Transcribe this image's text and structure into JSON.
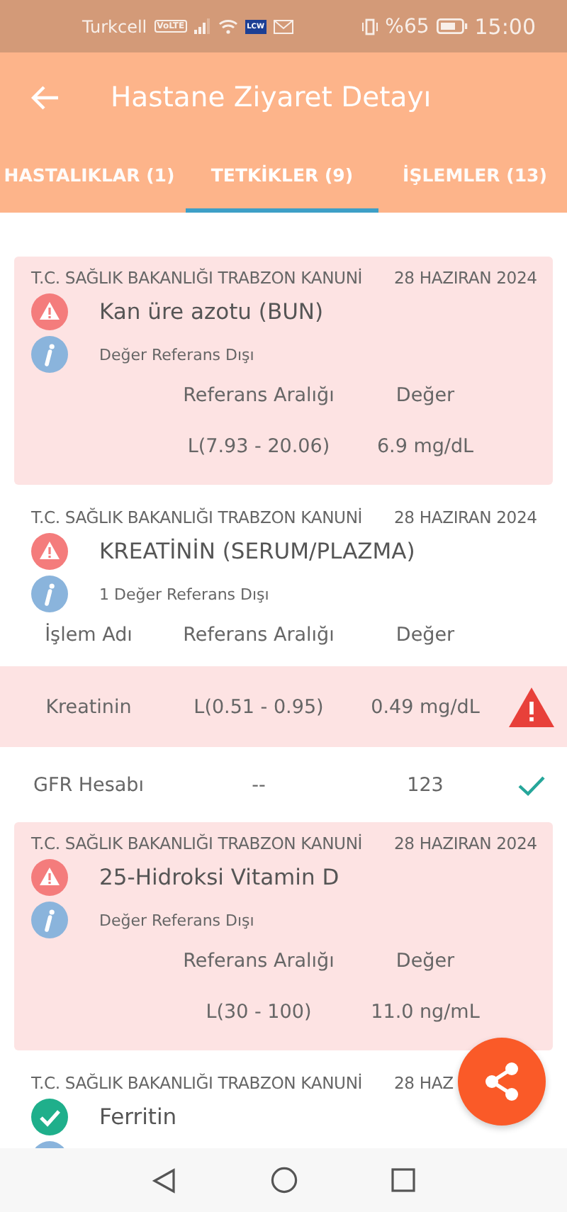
{
  "status_bar": {
    "carrier": "Turkcell",
    "volte": "VoLTE",
    "app_badge": "LCW",
    "battery": "%65",
    "time": "15:00"
  },
  "app_bar": {
    "title": "Hastane Ziyaret Detayı"
  },
  "tabs": [
    {
      "label": "HASTALIKLAR (1)",
      "selected": false
    },
    {
      "label": "TETKİKLER (9)",
      "selected": true
    },
    {
      "label": "İŞLEMLER (13)",
      "selected": false
    }
  ],
  "tests": [
    {
      "kind": "single",
      "out_of_range": true,
      "hospital": "T.C. SAĞLIK BAKANLIĞI TRABZON KANUNİ",
      "date": "28 HAZIRAN 2024",
      "title": "Kan üre azotu (BUN)",
      "subtitle": "Değer Referans Dışı",
      "columns": [
        "Referans Aralığı",
        "Değer"
      ],
      "rows": [
        {
          "range": "L(7.93 - 20.06)",
          "value": "6.9 mg/dL"
        }
      ]
    },
    {
      "kind": "multi",
      "out_of_range": true,
      "hospital": "T.C. SAĞLIK BAKANLIĞI TRABZON KANUNİ",
      "date": "28 HAZIRAN 2024",
      "title": "KREATİNİN (SERUM/PLAZMA)",
      "subtitle": "1 Değer Referans Dışı",
      "columns": [
        "İşlem Adı",
        "Referans Aralığı",
        "Değer"
      ],
      "rows": [
        {
          "name": "Kreatinin",
          "range": "L(0.51 - 0.95)",
          "value": "0.49 mg/dL",
          "out_of_range": true
        },
        {
          "name": "GFR Hesabı",
          "range": "--",
          "value": "123",
          "out_of_range": false
        }
      ]
    },
    {
      "kind": "single",
      "out_of_range": true,
      "hospital": "T.C. SAĞLIK BAKANLIĞI TRABZON KANUNİ",
      "date": "28 HAZIRAN 2024",
      "title": "25-Hidroksi Vitamin D",
      "subtitle": "Değer Referans Dışı",
      "columns": [
        "Referans Aralığı",
        "Değer"
      ],
      "rows": [
        {
          "range": "L(30 - 100)",
          "value": "11.0 ng/mL"
        }
      ]
    },
    {
      "kind": "single",
      "out_of_range": false,
      "hospital": "T.C. SAĞLIK BAKANLIĞI TRABZON KANUNİ",
      "date": "28 HAZ",
      "title": "Ferritin"
    }
  ]
}
